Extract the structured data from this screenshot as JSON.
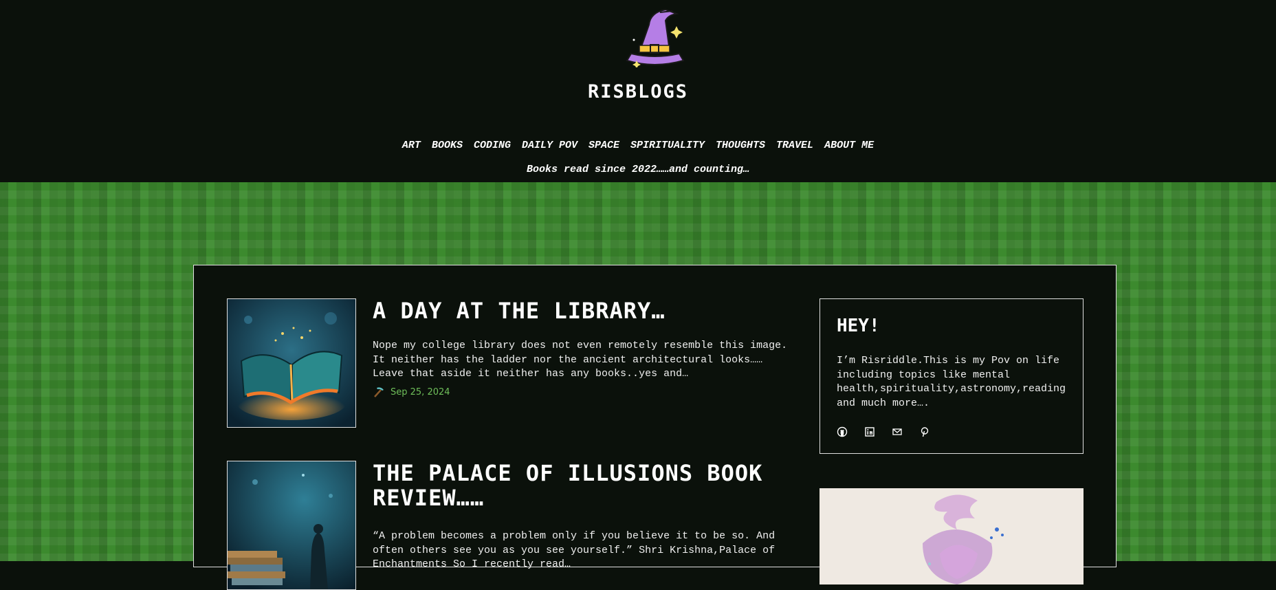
{
  "site": {
    "title": "RISBLOGS",
    "logo_icon": "wizard-hat-icon",
    "tagline": "Books read since 2022……and counting…"
  },
  "nav": {
    "items": [
      {
        "label": "ART"
      },
      {
        "label": "BOOKS"
      },
      {
        "label": "CODING"
      },
      {
        "label": "DAILY POV"
      },
      {
        "label": "SPACE"
      },
      {
        "label": "SPIRITUALITY"
      },
      {
        "label": "THOUGHTS"
      },
      {
        "label": "TRAVEL"
      },
      {
        "label": "ABOUT ME"
      }
    ]
  },
  "posts": [
    {
      "title": "A DAY AT THE LIBRARY…",
      "excerpt": "Nope my college library does not even remotely resemble this image. It neither has the ladder nor the ancient architectural looks…… Leave that aside it neither has any books..yes and…",
      "date": "Sep 25, 2024",
      "date_icon": "pickaxe-icon",
      "image": "open-book-image"
    },
    {
      "title": "THE PALACE OF ILLUSIONS BOOK REVIEW……",
      "excerpt": "“A problem becomes a problem only if you believe it to be so. And often others see you as you see yourself.” Shri Krishna,Palace of Enchantments So I recently read…",
      "image": "book-stack-image"
    }
  ],
  "sidebar": {
    "heading": "HEY!",
    "bio": "I’m Risriddle.This is my Pov on life including topics like mental health,spirituality,astronomy,reading and much more….",
    "socials": [
      "github-icon",
      "linkedin-icon",
      "mail-icon",
      "pinterest-icon"
    ],
    "image": "watercolor-wizard-image"
  },
  "colors": {
    "background": "#0b110b",
    "grass": "#3c8a2e",
    "accent": "#6fbf5a",
    "hat": "#b57ee6"
  }
}
